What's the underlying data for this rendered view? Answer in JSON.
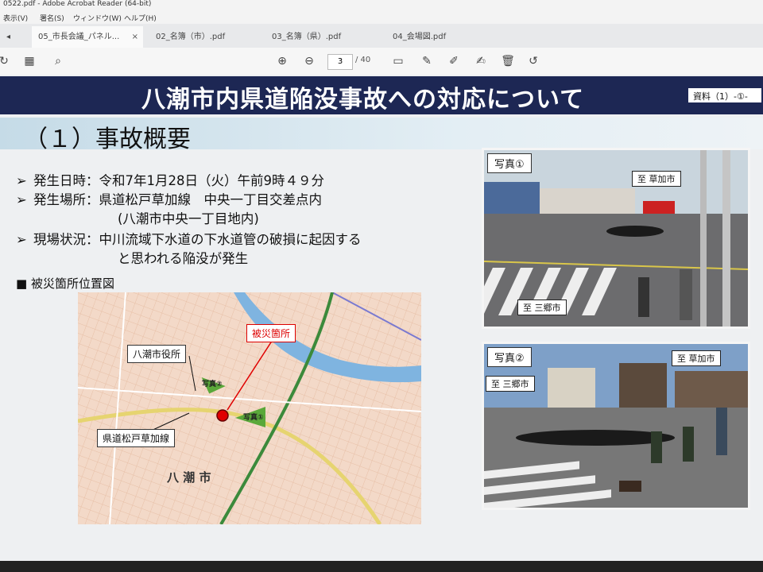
{
  "window": {
    "title": "0522.pdf - Adobe Acrobat Reader (64-bit)"
  },
  "menu": [
    "表示(V)",
    "署名(S)",
    "ウィンドウ(W)",
    "ヘルプ(H)"
  ],
  "tabs": [
    {
      "label": "05_市長会議_パネル...",
      "active": true
    },
    {
      "label": "02_名簿（市）.pdf",
      "active": false
    },
    {
      "label": "03_名簿（県）.pdf",
      "active": false
    },
    {
      "label": "04_会場図.pdf",
      "active": false
    }
  ],
  "toolbar": {
    "page_current": "3",
    "page_total": "/ 40"
  },
  "slide": {
    "title": "八潮市内県道陥没事故への対応について",
    "ref": "資料（1）-①-",
    "section": "（１）事故概要",
    "bullets": [
      "発生日時：令和7年1月28日（火）午前9時４９分",
      "発生場所：県道松戸草加線　中央一丁目交差点内",
      "(八潮市中央一丁目地内)",
      "現場状況：中川流域下水道の下水道管の破損に起因する",
      "と思われる陥没が発生"
    ],
    "map_caption": "■ 被災箇所位置図",
    "map": {
      "label_city_hall": "八潮市役所",
      "label_site": "被災箇所",
      "label_road": "県道松戸草加線",
      "label_city": "八 潮 市",
      "arrow_photo1": "写真①",
      "arrow_photo2": "写真②"
    },
    "photo1": {
      "label": "写真①",
      "sign_top": "至 草加市",
      "sign_bottom": "至 三郷市"
    },
    "photo2": {
      "label": "写真②",
      "sign_top": "至 草加市",
      "sign_left": "至 三郷市"
    }
  }
}
